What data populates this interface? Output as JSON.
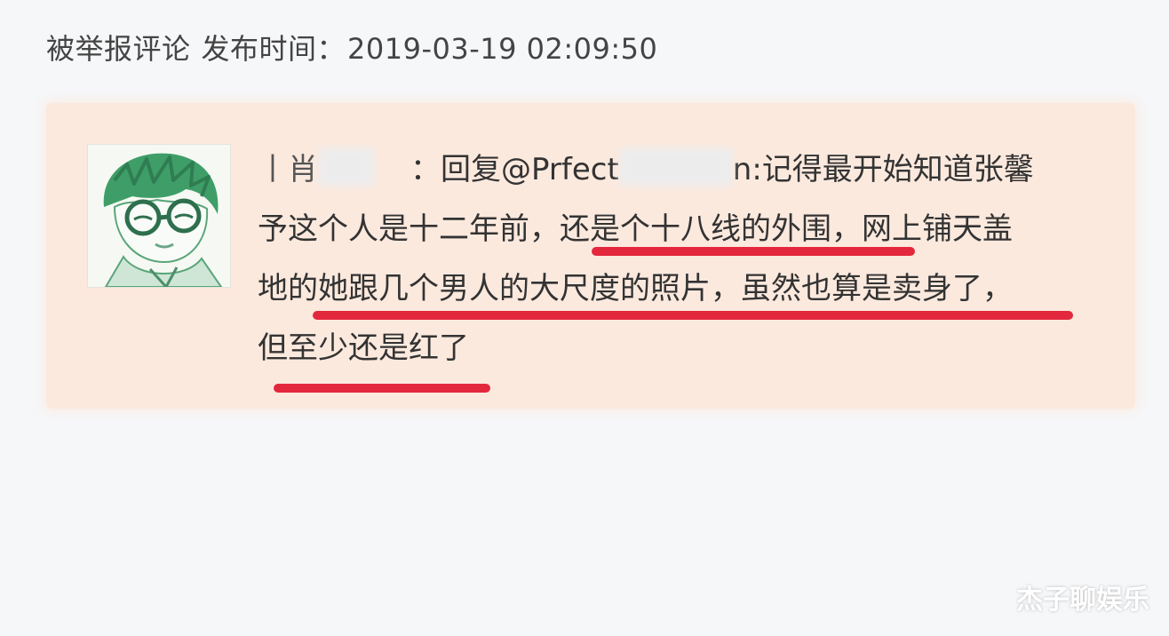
{
  "report": {
    "label": "被举报评论",
    "time_label": "发布时间：",
    "time_value": "2019-03-19 02:09:50"
  },
  "comment": {
    "user_prefix": "丨肖",
    "separator": "：",
    "reply_label": "回复@Prfect",
    "mention_suffix": "n:",
    "line1_rest": "记得最开始知道张馨",
    "line2_a": "予这个人是十二年前，",
    "line2_b": "还是个十八线的外围，",
    "line2_c": "网上铺天盖",
    "line3_a": "地的",
    "line3_b": "她跟几个男人的大尺度的照片，虽然也算是卖身了，",
    "line4_a": "但至少还是红了"
  },
  "watermark": "杰子聊娱乐",
  "colors": {
    "highlight_underline": "#e3283e",
    "comment_background": "#fce9de",
    "page_background": "#f6f7f9"
  },
  "icons": {
    "avatar": "cartoon-boy-with-glasses"
  }
}
